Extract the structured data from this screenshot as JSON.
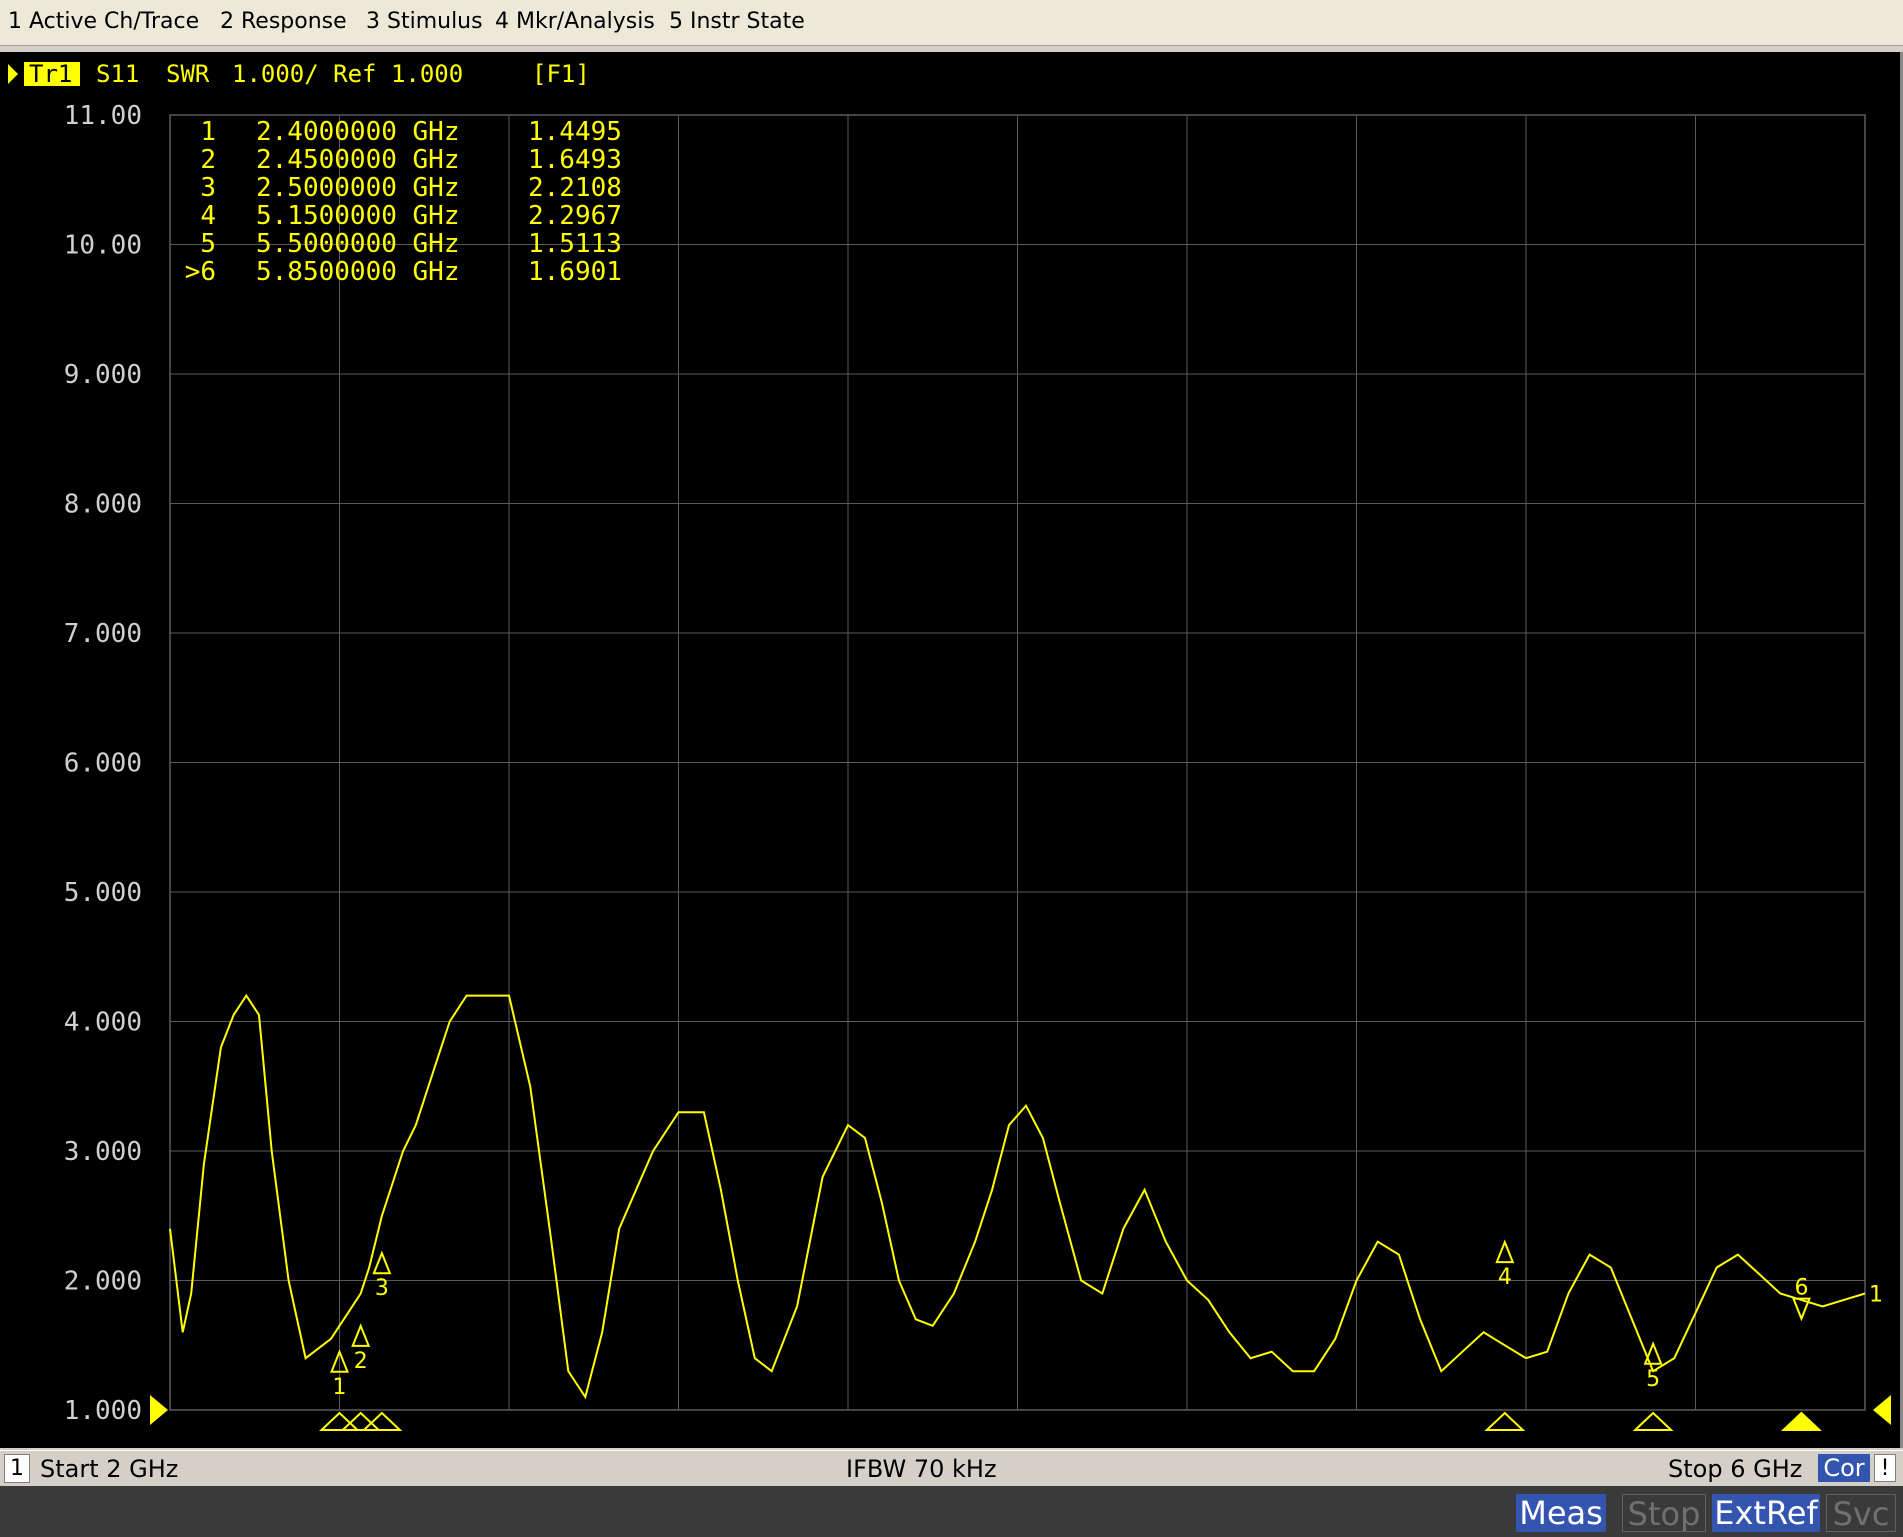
{
  "menu": [
    {
      "label": "1 Active Ch/Trace"
    },
    {
      "label": "2 Response"
    },
    {
      "label": "3 Stimulus"
    },
    {
      "label": "4 Mkr/Analysis"
    },
    {
      "label": "5 Instr State"
    }
  ],
  "trace_header": {
    "trace_id": "Tr1",
    "measurement": "S11",
    "format": "SWR",
    "scale_ref": "1.000/ Ref 1.000",
    "func": "[F1]"
  },
  "status_bar": {
    "channel": "1",
    "start": "Start 2 GHz",
    "ifbw": "IFBW 70 kHz",
    "stop": "Stop 6 GHz",
    "cor": "Cor",
    "excl": "!"
  },
  "bottom_buttons": {
    "meas": "Meas",
    "stop": "Stop",
    "extref": "ExtRef",
    "svc": "Svc"
  },
  "chart_data": {
    "type": "line",
    "xlim": [
      2.0,
      6.0
    ],
    "ylim": [
      1.0,
      11.0
    ],
    "x_divisions": 10,
    "y_ticks": [
      "1.000",
      "2.000",
      "3.000",
      "4.000",
      "5.000",
      "6.000",
      "7.000",
      "8.000",
      "9.000",
      "10.00",
      "11.00"
    ],
    "grid": true,
    "colors": {
      "background": "#000000",
      "grid": "#5a5a5a",
      "trace": "#ffff00",
      "axis_text": "#d0d0d0"
    },
    "series": [
      {
        "x": [
          2.0,
          2.03,
          2.05,
          2.08,
          2.12,
          2.15,
          2.18,
          2.21,
          2.24,
          2.28,
          2.32,
          2.36,
          2.38,
          2.4,
          2.42,
          2.45,
          2.47,
          2.5,
          2.55,
          2.58,
          2.62,
          2.66,
          2.7,
          2.74,
          2.8,
          2.85,
          2.9,
          2.94,
          2.98,
          3.02,
          3.06,
          3.1,
          3.14,
          3.2,
          3.26,
          3.3,
          3.34,
          3.38,
          3.42,
          3.48,
          3.54,
          3.6,
          3.64,
          3.68,
          3.72,
          3.76,
          3.8,
          3.85,
          3.9,
          3.94,
          3.98,
          4.02,
          4.06,
          4.1,
          4.15,
          4.2,
          4.25,
          4.3,
          4.35,
          4.4,
          4.45,
          4.5,
          4.55,
          4.6,
          4.65,
          4.7,
          4.75,
          4.8,
          4.85,
          4.9,
          4.95,
          5.0,
          5.05,
          5.1,
          5.15,
          5.2,
          5.25,
          5.3,
          5.35,
          5.4,
          5.45,
          5.5,
          5.55,
          5.6,
          5.65,
          5.7,
          5.75,
          5.8,
          5.85,
          5.9,
          5.95,
          6.0
        ],
        "y": [
          2.4,
          1.6,
          1.9,
          2.9,
          3.8,
          4.05,
          4.2,
          4.05,
          3.0,
          2.0,
          1.4,
          1.5,
          1.55,
          1.65,
          1.75,
          1.9,
          2.1,
          2.5,
          3.0,
          3.2,
          3.6,
          4.0,
          4.2,
          4.2,
          4.2,
          3.5,
          2.3,
          1.3,
          1.1,
          1.6,
          2.4,
          2.7,
          3.0,
          3.3,
          3.3,
          2.7,
          2.0,
          1.4,
          1.3,
          1.8,
          2.8,
          3.2,
          3.1,
          2.6,
          2.0,
          1.7,
          1.65,
          1.9,
          2.3,
          2.7,
          3.2,
          3.35,
          3.1,
          2.6,
          2.0,
          1.9,
          2.4,
          2.7,
          2.3,
          2.0,
          1.85,
          1.6,
          1.4,
          1.45,
          1.3,
          1.3,
          1.55,
          2.0,
          2.3,
          2.2,
          1.7,
          1.3,
          1.45,
          1.6,
          1.5,
          1.4,
          1.45,
          1.9,
          2.2,
          2.1,
          1.7,
          1.3,
          1.4,
          1.75,
          2.1,
          2.2,
          2.05,
          1.9,
          1.85,
          1.8,
          1.85,
          1.9
        ]
      }
    ],
    "markers": [
      {
        "label": "1",
        "freq": "2.4000000 GHz",
        "freq_ghz": 2.4,
        "value": "1.4495",
        "y": 1.4495
      },
      {
        "label": "2",
        "freq": "2.4500000 GHz",
        "freq_ghz": 2.45,
        "value": "1.6493",
        "y": 1.6493
      },
      {
        "label": "3",
        "freq": "2.5000000 GHz",
        "freq_ghz": 2.5,
        "value": "2.2108",
        "y": 2.2108
      },
      {
        "label": "4",
        "freq": "5.1500000 GHz",
        "freq_ghz": 5.15,
        "value": "2.2967",
        "y": 2.2967
      },
      {
        "label": "5",
        "freq": "5.5000000 GHz",
        "freq_ghz": 5.5,
        "value": "1.5113",
        "y": 1.5113
      },
      {
        "label": "6",
        "freq": "5.8500000 GHz",
        "freq_ghz": 5.85,
        "value": "1.6901",
        "y": 1.6901,
        "active": true
      }
    ],
    "active_marker_prefix": ">",
    "ref_marker_label": "1"
  }
}
